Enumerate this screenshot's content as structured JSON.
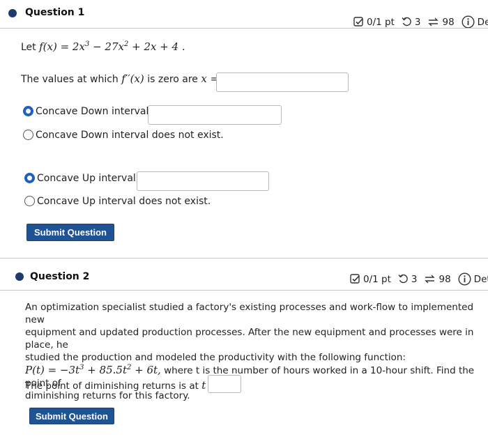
{
  "q1": {
    "title": "Question 1",
    "meta": {
      "score": "0/1 pt",
      "retries": "3",
      "submissions": "98",
      "details": "Deta"
    },
    "problem": {
      "let": "Let",
      "function": "f(x) = 2x",
      "exp3": "3",
      "mid": " − 27x",
      "exp2": "2",
      "tail": " + 2x + 4 ."
    },
    "inflection_prompt": "The values at which",
    "inflection_fn": "f′′(x)",
    "inflection_rest": "is zero are",
    "inflection_var": "x =",
    "concave_down_option": "Concave Down interval is",
    "concave_down_none": "Concave Down interval does not exist.",
    "concave_up_option": "Concave Up interval is",
    "concave_up_none": "Concave Up interval does not exist.",
    "submit_label": "Submit Question"
  },
  "q2": {
    "title": "Question 2",
    "meta": {
      "score": "0/1 pt",
      "retries": "3",
      "submissions": "98",
      "details": "Details"
    },
    "paragraph_line1": "An optimization specialist studied a factory's existing processes and work-flow to implemented new",
    "paragraph_line2": "equipment and updated production processes. After the new equipment and processes were in place, he",
    "paragraph_line3": "studied the production and modeled the productivity with the following function:",
    "formula_lhs": "P(t) = −3t",
    "formula_exp3": "3",
    "formula_mid": " + 85.5t",
    "formula_exp2": "2",
    "formula_tail": " + 6t,",
    "formula_rest": " where t is the number of hours worked in a 10-hour shift. Find the point of",
    "paragraph_line5": "diminishing returns for this factory.",
    "answer_prompt": "The point of diminishing returns is at",
    "answer_var": "t =",
    "submit_label": "Submit Question"
  },
  "colors": {
    "accent": "#1f5394",
    "radio_selected": "#1f5fbf",
    "bullet": "#1d3a6e"
  }
}
